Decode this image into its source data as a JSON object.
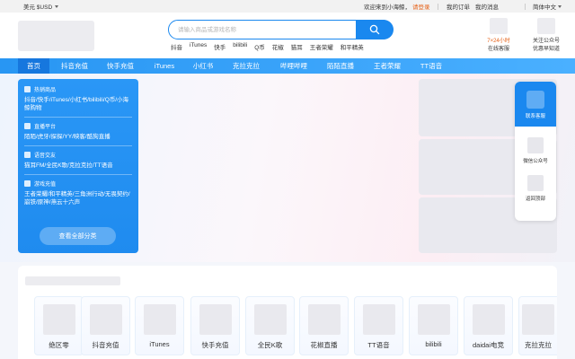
{
  "topbar": {
    "currency": "美元 $USD",
    "welcome": "欢迎来到小海鲸，",
    "login": "请登录",
    "orders": "我的订单",
    "messages": "我的消息",
    "language": "简体中文"
  },
  "search": {
    "placeholder": "请输入商品或游戏名称"
  },
  "hot_links": [
    "抖音",
    "iTunes",
    "快手",
    "bilibili",
    "Q币",
    "花椒",
    "猫耳",
    "王者荣耀",
    "和平精英"
  ],
  "header_right": {
    "hotline_line1": "7×24小时",
    "hotline_line2": "在线客服",
    "wechat_line1": "关注公众号",
    "wechat_line2": "优惠早知道"
  },
  "nav": [
    "首页",
    "抖音充值",
    "快手充值",
    "iTunes",
    "小红书",
    "克拉克拉",
    "哔哩哔哩",
    "陌陌直播",
    "王者荣耀",
    "TT语音"
  ],
  "categories": [
    {
      "title": "热销商品",
      "items": "抖音/快手/iTunes/小红书/bilibili/Q币/小海鲸购物"
    },
    {
      "title": "直播平台",
      "items": "陌陌/虎牙/探探/YY/映客/酷狗直播"
    },
    {
      "title": "语音交友",
      "items": "猫耳FM/全民K歌/克拉克拉/TT语音"
    },
    {
      "title": "游戏充值",
      "items": "王者荣耀/和平精英/三角洲行动/无畏契约/崩铁/原神/燕云十六声"
    }
  ],
  "view_all": "查看全部分类",
  "float_bar": {
    "service": "联系客服",
    "wechat": "微信公众号",
    "top": "返回顶部"
  },
  "games": [
    "绝区零",
    "抖音充值",
    "iTunes",
    "快手充值",
    "全民K歌",
    "花椒直播",
    "TT语音",
    "bilibili",
    "daidai电竞",
    "克拉克拉"
  ],
  "colors": {
    "primary": "#1a88ef",
    "accent": "#e6631a"
  }
}
